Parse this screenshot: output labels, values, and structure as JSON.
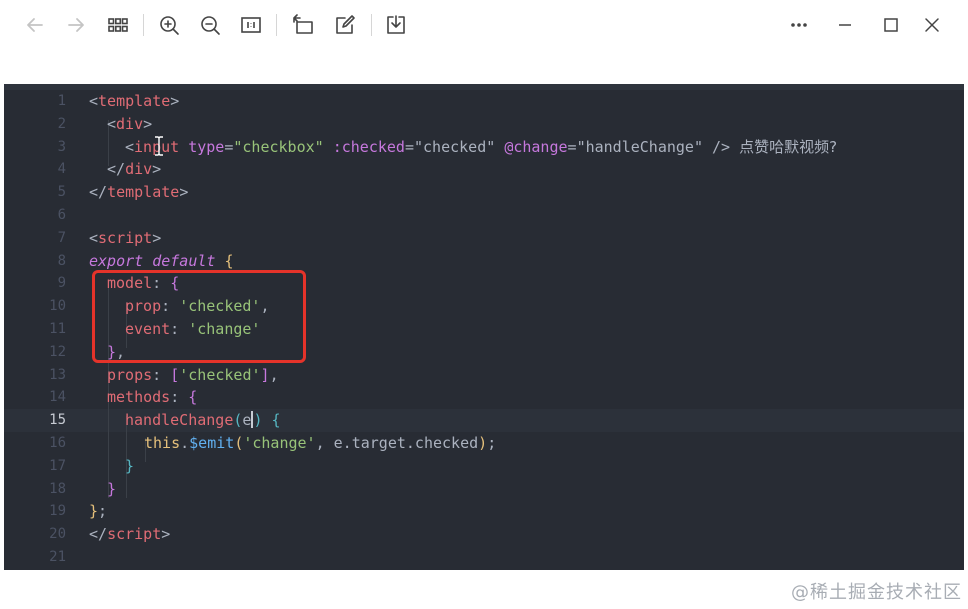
{
  "toolbar": {
    "buttons": [
      "back-arrow",
      "forward-arrow",
      "grid-view",
      "zoom-in",
      "zoom-out",
      "actual-size",
      "rotate",
      "edit",
      "download"
    ],
    "window_controls": [
      "more",
      "minimize",
      "maximize",
      "close"
    ]
  },
  "editor": {
    "active_line": 15,
    "line_numbers": [
      "1",
      "2",
      "3",
      "4",
      "5",
      "6",
      "7",
      "8",
      "9",
      "10",
      "11",
      "12",
      "13",
      "14",
      "15",
      "16",
      "17",
      "18",
      "19",
      "20",
      "21"
    ],
    "code": {
      "l1": {
        "open": "<",
        "tag": "template",
        "close": ">"
      },
      "l2": {
        "open": "<",
        "tag": "div",
        "close": ">"
      },
      "l3": {
        "open": "<",
        "tag": "input",
        "a1": "type",
        "eq1": "=",
        "v1": "\"checkbox\"",
        "a2": ":checked",
        "eq2": "=",
        "v2": "\"checked\"",
        "a3": "@change",
        "eq3": "=",
        "v3": "\"handleChange\"",
        "selfclose": "/>",
        "text": "点赞哈默视频?"
      },
      "l4": {
        "open": "</",
        "tag": "div",
        "close": ">"
      },
      "l5": {
        "open": "</",
        "tag": "template",
        "close": ">"
      },
      "l7": {
        "open": "<",
        "tag": "script",
        "close": ">"
      },
      "l8": {
        "kw1": "export",
        "kw2": "default",
        "brace": "{"
      },
      "l9": {
        "key": "model",
        "colon": ":",
        "brace": "{"
      },
      "l10": {
        "key": "prop",
        "colon": ":",
        "val": "'checked'",
        "comma": ","
      },
      "l11": {
        "key": "event",
        "colon": ":",
        "val": "'change'"
      },
      "l12": {
        "brace": "}",
        "comma": ","
      },
      "l13": {
        "key": "props",
        "colon": ":",
        "ob": "[",
        "val": "'checked'",
        "cb": "]",
        "comma": ","
      },
      "l14": {
        "key": "methods",
        "colon": ":",
        "brace": "{"
      },
      "l15": {
        "fn": "handleChange",
        "op": "(",
        "param": "e",
        "cp": ")",
        "brace": "{"
      },
      "l16": {
        "this": "this",
        "dot": ".",
        "fn": "$emit",
        "op": "(",
        "v1": "'change'",
        "comma": ",",
        "rest": "e.target.checked",
        "cp": ")",
        "semi": ";"
      },
      "l17": {
        "brace": "}"
      },
      "l18": {
        "brace": "}"
      },
      "l19": {
        "brace": "}",
        "semi": ";"
      },
      "l20": {
        "open": "</",
        "tag": "script",
        "close": ">"
      }
    }
  },
  "watermark": "@稀土掘金技术社区",
  "colors": {
    "editor_bg": "#282c34",
    "highlight_box": "#e5332a",
    "tag": "#e06c75",
    "string": "#98c379",
    "keyword": "#c678dd"
  }
}
